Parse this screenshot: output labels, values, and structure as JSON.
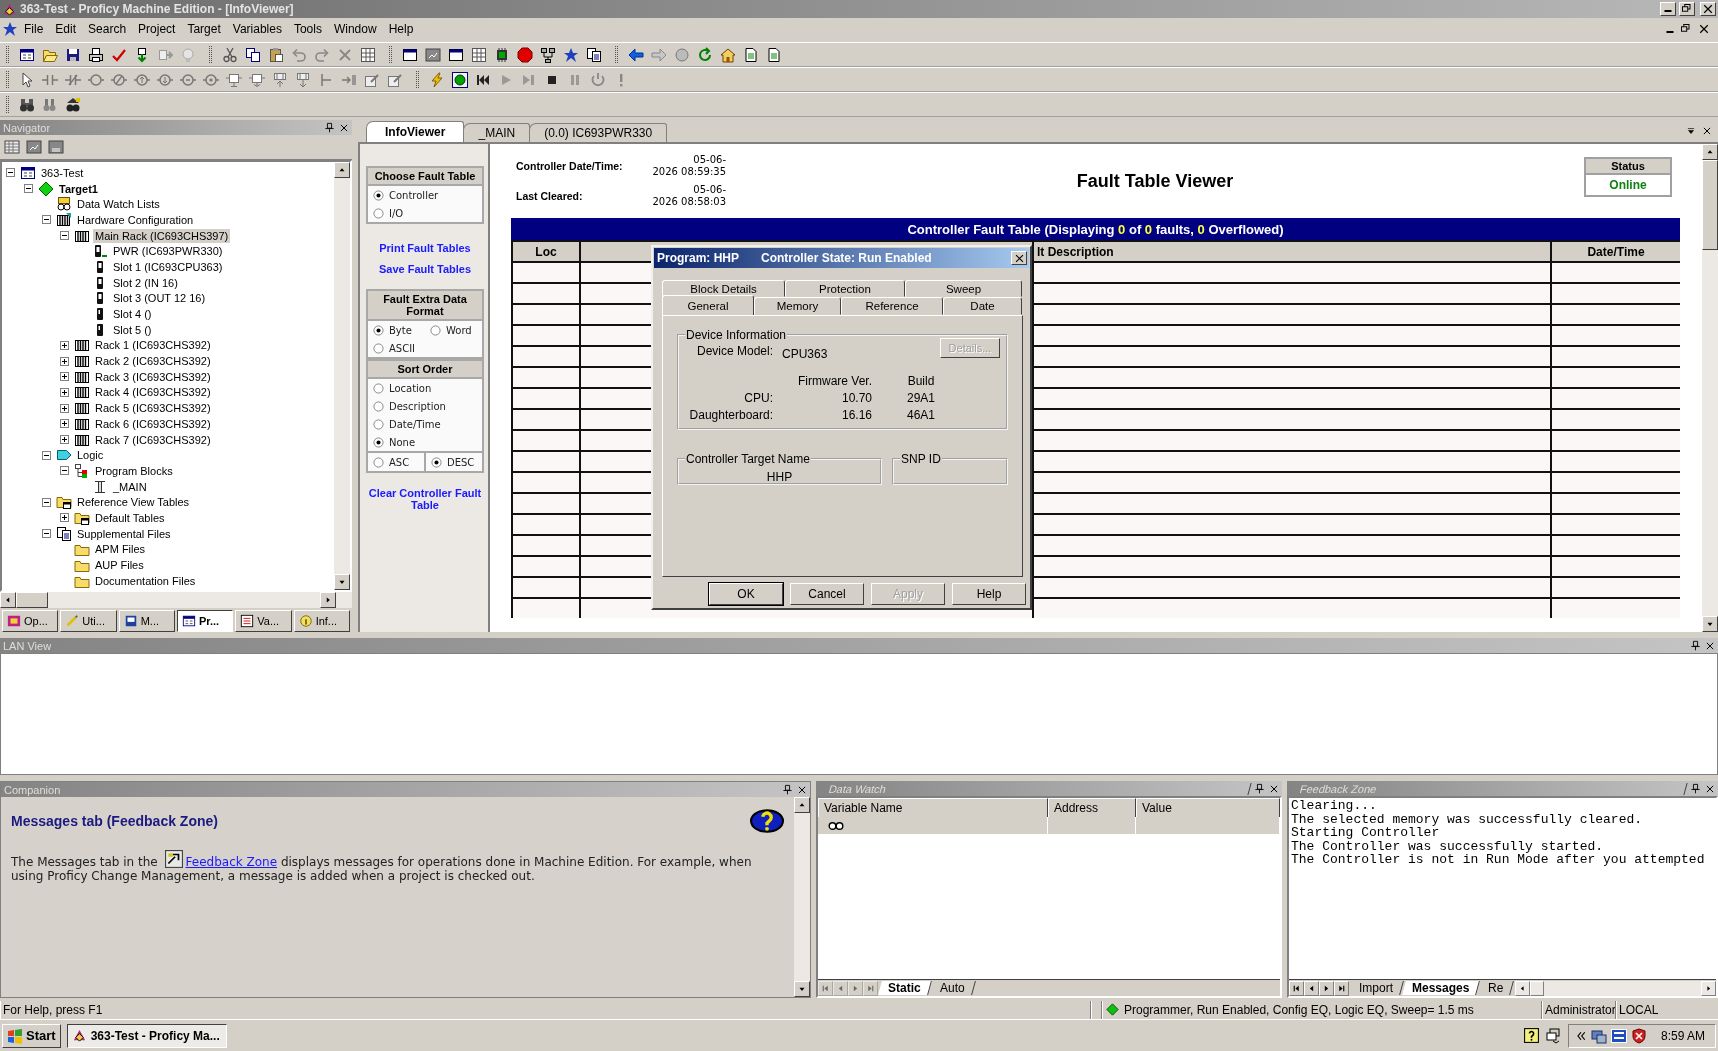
{
  "window": {
    "title": "363-Test - Proficy Machine Edition - [InfoViewer]"
  },
  "menu": [
    "File",
    "Edit",
    "Search",
    "Project",
    "Target",
    "Variables",
    "Tools",
    "Window",
    "Help"
  ],
  "navigator": {
    "title": "Navigator",
    "tree": [
      {
        "label": "363-Test",
        "kind": "project",
        "expanded": true,
        "selected": false,
        "children": [
          {
            "label": "Target1",
            "kind": "target",
            "expanded": true,
            "selected": false,
            "active": true,
            "children": [
              {
                "label": "Data Watch Lists",
                "kind": "watch",
                "selected": false
              },
              {
                "label": "Hardware Configuration",
                "kind": "hardware",
                "expanded": true,
                "selected": false,
                "children": [
                  {
                    "label": "Main Rack (IC693CHS397)",
                    "kind": "rack",
                    "expanded": true,
                    "selected": true,
                    "children": [
                      {
                        "label": "PWR (IC693PWR330)",
                        "kind": "power",
                        "selected": false
                      },
                      {
                        "label": "Slot 1 (IC693CPU363)",
                        "kind": "module",
                        "selected": false
                      },
                      {
                        "label": "Slot 2 (IN 16)",
                        "kind": "module",
                        "selected": false
                      },
                      {
                        "label": "Slot 3 (OUT 12 16)",
                        "kind": "module",
                        "selected": false
                      },
                      {
                        "label": "Slot 4 ()",
                        "kind": "slot",
                        "selected": false
                      },
                      {
                        "label": "Slot 5 ()",
                        "kind": "slot",
                        "selected": false
                      }
                    ]
                  },
                  {
                    "label": "Rack 1 (IC693CHS392)",
                    "kind": "rack",
                    "expanded": false,
                    "selected": false
                  },
                  {
                    "label": "Rack 2 (IC693CHS392)",
                    "kind": "rack",
                    "expanded": false,
                    "selected": false
                  },
                  {
                    "label": "Rack 3 (IC693CHS392)",
                    "kind": "rack",
                    "expanded": false,
                    "selected": false
                  },
                  {
                    "label": "Rack 4 (IC693CHS392)",
                    "kind": "rack",
                    "expanded": false,
                    "selected": false
                  },
                  {
                    "label": "Rack 5 (IC693CHS392)",
                    "kind": "rack",
                    "expanded": false,
                    "selected": false
                  },
                  {
                    "label": "Rack 6 (IC693CHS392)",
                    "kind": "rack",
                    "expanded": false,
                    "selected": false
                  },
                  {
                    "label": "Rack 7 (IC693CHS392)",
                    "kind": "rack",
                    "expanded": false,
                    "selected": false
                  }
                ]
              },
              {
                "label": "Logic",
                "kind": "logic",
                "expanded": true,
                "selected": false,
                "children": [
                  {
                    "label": "Program Blocks",
                    "kind": "blocks",
                    "expanded": true,
                    "selected": false,
                    "children": [
                      {
                        "label": "_MAIN",
                        "kind": "block",
                        "selected": false
                      }
                    ]
                  }
                ]
              },
              {
                "label": "Reference View Tables",
                "kind": "tables",
                "expanded": true,
                "selected": false,
                "children": [
                  {
                    "label": "Default Tables",
                    "kind": "tables",
                    "expanded": false,
                    "selected": false
                  }
                ]
              },
              {
                "label": "Supplemental Files",
                "kind": "files",
                "expanded": true,
                "selected": false,
                "children": [
                  {
                    "label": "APM Files",
                    "kind": "folder",
                    "selected": false
                  },
                  {
                    "label": "AUP Files",
                    "kind": "folder",
                    "selected": false
                  },
                  {
                    "label": "Documentation Files",
                    "kind": "folder",
                    "selected": false
                  }
                ]
              }
            ]
          }
        ]
      }
    ],
    "tabs": [
      {
        "label": "Op...",
        "kind": "options",
        "selected": false
      },
      {
        "label": "Uti...",
        "kind": "utilities",
        "selected": false
      },
      {
        "label": "M...",
        "kind": "manuals",
        "selected": false
      },
      {
        "label": "Pr...",
        "kind": "project",
        "selected": true
      },
      {
        "label": "Va...",
        "kind": "variables",
        "selected": false
      },
      {
        "label": "Inf...",
        "kind": "info",
        "selected": false
      }
    ]
  },
  "info_viewer": {
    "tabs": [
      {
        "label": "InfoViewer",
        "selected": true
      },
      {
        "label": "_MAIN",
        "selected": false
      },
      {
        "label": "(0.0) IC693PWR330",
        "selected": false
      }
    ],
    "fault_panel": {
      "choose_fault_table": {
        "title": "Choose Fault Table",
        "options": [
          {
            "label": "Controller",
            "selected": true
          },
          {
            "label": "I/O",
            "selected": false
          }
        ]
      },
      "links": [
        "Print Fault Tables",
        "Save Fault Tables"
      ],
      "extra_data_format": {
        "title": "Fault Extra Data Format",
        "options": [
          {
            "label": "Byte",
            "selected": true
          },
          {
            "label": "Word",
            "selected": false
          },
          {
            "label": "ASCII",
            "selected": false
          }
        ]
      },
      "sort_order": {
        "title": "Sort Order",
        "options": [
          {
            "label": "Location",
            "selected": false
          },
          {
            "label": "Description",
            "selected": false
          },
          {
            "label": "Date/Time",
            "selected": false
          },
          {
            "label": "None",
            "selected": true
          }
        ],
        "direction": [
          {
            "label": "ASC",
            "selected": false
          },
          {
            "label": "DESC",
            "selected": true
          }
        ]
      },
      "clear_link": "Clear Controller Fault Table"
    },
    "controller_datetime": {
      "label": "Controller Date/Time:",
      "value": "05-06-\n2026 08:59:35"
    },
    "last_cleared": {
      "label": "Last Cleared:",
      "value": "05-06-\n2026 08:58:03"
    },
    "title": "Fault Table Viewer",
    "status": {
      "label": "Status",
      "value": "Online"
    },
    "fault_table": {
      "caption": [
        {
          "text": "Controller Fault Table (Displaying ",
          "highlight": false
        },
        {
          "text": "0",
          "highlight": true
        },
        {
          "text": " of ",
          "highlight": false
        },
        {
          "text": "0",
          "highlight": true
        },
        {
          "text": " faults, ",
          "highlight": false
        },
        {
          "text": "0",
          "highlight": true
        },
        {
          "text": " Overflowed)",
          "highlight": false
        }
      ],
      "columns": [
        "Loc",
        "lt Description",
        "Date/Time"
      ]
    }
  },
  "dialog": {
    "title_program": "Program: HHP",
    "title_state": "Controller State: Run Enabled",
    "tabs_back": [
      {
        "label": "Block Details",
        "selected": false
      },
      {
        "label": "Protection",
        "selected": false
      },
      {
        "label": "Sweep",
        "selected": false
      }
    ],
    "tabs_front": [
      {
        "label": "General",
        "selected": true
      },
      {
        "label": "Memory",
        "selected": false
      },
      {
        "label": "Reference",
        "selected": false
      },
      {
        "label": "Date",
        "selected": false
      }
    ],
    "device_information": {
      "title": "Device Information",
      "model_label": "Device Model:",
      "model": "CPU363",
      "details_button": {
        "label": "Details...",
        "disabled": true
      },
      "headers": [
        "Firmware Ver.",
        "Build"
      ],
      "rows": [
        {
          "label": "CPU:",
          "firmware": "10.70",
          "build": "29A1"
        },
        {
          "label": "Daughterboard:",
          "firmware": "16.16",
          "build": "46A1"
        }
      ]
    },
    "target_name": {
      "title": "Controller Target Name",
      "value": "HHP"
    },
    "snp_id": {
      "title": "SNP ID"
    },
    "buttons": [
      {
        "label": "OK",
        "disabled": false,
        "default": true
      },
      {
        "label": "Cancel",
        "disabled": false,
        "default": false
      },
      {
        "label": "Apply",
        "disabled": true,
        "default": false
      },
      {
        "label": "Help",
        "disabled": false,
        "default": false
      }
    ]
  },
  "lan_view": {
    "title": "LAN View"
  },
  "companion": {
    "title": "Companion",
    "heading": "Messages tab (Feedback Zone)",
    "text_before": "The Messages tab in the",
    "link": "Feedback Zone",
    "text_after": "displays messages for operations done in Machine Edition. For example, when using Proficy Change Management, a message is added when a project is checked out."
  },
  "data_watch": {
    "title": "Data Watch",
    "columns": [
      "Variable Name",
      "Address",
      "Value"
    ],
    "tabs": [
      {
        "label": "Static",
        "selected": true
      },
      {
        "label": "Auto",
        "selected": false
      }
    ]
  },
  "feedback_zone": {
    "title": "Feedback Zone",
    "lines": [
      "Clearing...",
      "The selected memory was successfully cleared.",
      "Starting Controller",
      "The Controller was successfully started.",
      "The Controller is not in Run Mode after you attempted"
    ],
    "tabs": [
      {
        "label": "Import",
        "selected": false
      },
      {
        "label": "Messages",
        "selected": true
      },
      {
        "label": "Re",
        "selected": false
      }
    ]
  },
  "status_bar": {
    "help": "For Help, press F1",
    "state": "Programmer, Run Enabled, Config EQ, Logic EQ, Sweep=  1.5 ms",
    "user": "Administrator",
    "location": "LOCAL"
  },
  "taskbar": {
    "start": "Start",
    "tasks": [
      {
        "label": "363-Test - Proficy Ma...",
        "selected": true
      }
    ],
    "clock": "8:59 AM"
  }
}
